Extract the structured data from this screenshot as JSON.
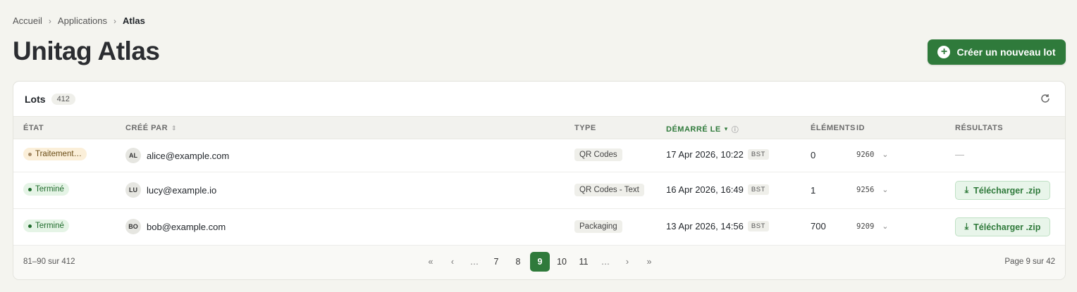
{
  "breadcrumb": [
    "Accueil",
    "Applications",
    "Atlas"
  ],
  "page_title": "Unitag Atlas",
  "create_button": "Créer un nouveau lot",
  "card": {
    "title": "Lots",
    "count": "412"
  },
  "columns": {
    "state": "ÉTAT",
    "created_by": "CRÉÉ PAR",
    "type": "TYPE",
    "started": "DÉMARRÉ LE",
    "elements": "ÉLÉMENTS",
    "id": "ID",
    "results": "RÉSULTATS"
  },
  "rows": [
    {
      "status": "Traitement…",
      "status_kind": "processing",
      "initials": "AL",
      "email": "alice@example.com",
      "type": "QR Codes",
      "date": "17 Apr 2026, 10:22",
      "tz": "BST",
      "elements": "0",
      "id": "9260",
      "result": "—"
    },
    {
      "status": "Terminé",
      "status_kind": "done",
      "initials": "LU",
      "email": "lucy@example.io",
      "type": "QR Codes - Text",
      "date": "16 Apr 2026, 16:49",
      "tz": "BST",
      "elements": "1",
      "id": "9256",
      "result": "Télécharger .zip"
    },
    {
      "status": "Terminé",
      "status_kind": "done",
      "initials": "BO",
      "email": "bob@example.com",
      "type": "Packaging",
      "date": "13 Apr 2026, 14:56",
      "tz": "BST",
      "elements": "700",
      "id": "9209",
      "result": "Télécharger .zip"
    }
  ],
  "footer": {
    "range": "81–90 sur 412",
    "page": "Page 9 sur 42",
    "pager": [
      "«",
      "‹",
      "…",
      "7",
      "8",
      "9",
      "10",
      "11",
      "…",
      "›",
      "»"
    ],
    "current_page": "9"
  },
  "colors": {
    "accent": "#2f7a3b",
    "processing_bg": "#fbefd9",
    "done_bg": "#e5f4e6"
  }
}
